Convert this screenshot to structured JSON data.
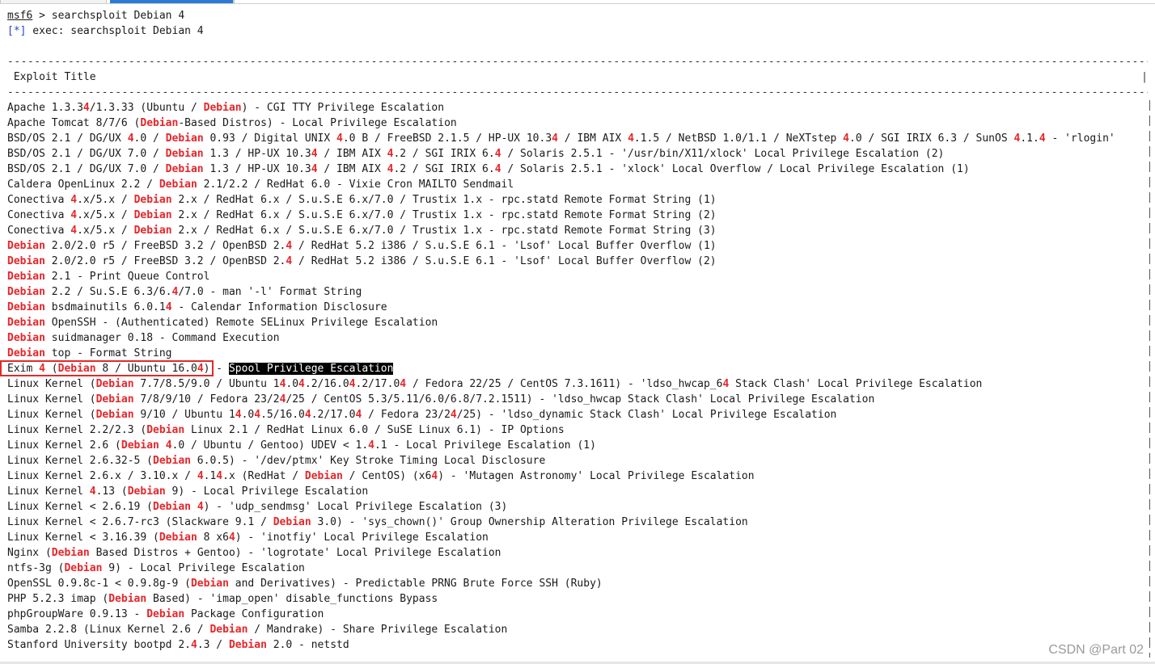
{
  "prompt": {
    "name": "msf6",
    "symbol": " > ",
    "command": "searchsploit Debian 4"
  },
  "exec_line": {
    "tag": "[*]",
    "text": " exec: searchsploit Debian 4"
  },
  "table": {
    "dash_rule": "----------------------------------------------------------------------------------------------------------------------------------------------------------------------------------------------------",
    "header": " Exploit Title",
    "header_edge": "|"
  },
  "rows": [
    [
      [
        "Apache 1.3.3",
        ""
      ],
      [
        "4",
        "r"
      ],
      [
        "/1.3.33 (Ubuntu / ",
        ""
      ],
      [
        "Debian",
        "r"
      ],
      [
        ") - CGI TTY Privilege Escalation",
        ""
      ]
    ],
    [
      [
        "Apache Tomcat 8/7/6 (",
        ""
      ],
      [
        "Debian",
        "r"
      ],
      [
        "-Based Distros) - Local Privilege Escalation",
        ""
      ]
    ],
    [
      [
        "BSD/OS 2.1 / DG/UX ",
        ""
      ],
      [
        "4",
        "r"
      ],
      [
        ".0 / ",
        ""
      ],
      [
        "Debian",
        "r"
      ],
      [
        " 0.93 / Digital UNIX ",
        ""
      ],
      [
        "4",
        "r"
      ],
      [
        ".0 B / FreeBSD 2.1.5 / HP-UX 10.3",
        ""
      ],
      [
        "4",
        "r"
      ],
      [
        " / IBM AIX ",
        ""
      ],
      [
        "4",
        "r"
      ],
      [
        ".1.5 / NetBSD 1.0/1.1 / NeXTstep ",
        ""
      ],
      [
        "4",
        "r"
      ],
      [
        ".0 / SGI IRIX 6.3 / SunOS ",
        ""
      ],
      [
        "4",
        "r"
      ],
      [
        ".1.",
        ""
      ],
      [
        "4",
        "r"
      ],
      [
        " - 'rlogin'",
        ""
      ]
    ],
    [
      [
        "BSD/OS 2.1 / DG/UX 7.0 / ",
        ""
      ],
      [
        "Debian",
        "r"
      ],
      [
        " 1.3 / HP-UX 10.3",
        ""
      ],
      [
        "4",
        "r"
      ],
      [
        " / IBM AIX ",
        ""
      ],
      [
        "4",
        "r"
      ],
      [
        ".2 / SGI IRIX 6.",
        ""
      ],
      [
        "4",
        "r"
      ],
      [
        " / Solaris 2.5.1 - '/usr/bin/X11/xlock' Local Privilege Escalation (2)",
        ""
      ]
    ],
    [
      [
        "BSD/OS 2.1 / DG/UX 7.0 / ",
        ""
      ],
      [
        "Debian",
        "r"
      ],
      [
        " 1.3 / HP-UX 10.3",
        ""
      ],
      [
        "4",
        "r"
      ],
      [
        " / IBM AIX ",
        ""
      ],
      [
        "4",
        "r"
      ],
      [
        ".2 / SGI IRIX 6.",
        ""
      ],
      [
        "4",
        "r"
      ],
      [
        " / Solaris 2.5.1 - 'xlock' Local Overflow / Local Privilege Escalation (1)",
        ""
      ]
    ],
    [
      [
        "Caldera OpenLinux 2.2 / ",
        ""
      ],
      [
        "Debian",
        "r"
      ],
      [
        " 2.1/2.2 / RedHat 6.0 - Vixie Cron MAILTO Sendmail",
        ""
      ]
    ],
    [
      [
        "Conectiva ",
        ""
      ],
      [
        "4",
        "r"
      ],
      [
        ".x/5.x / ",
        ""
      ],
      [
        "Debian",
        "r"
      ],
      [
        " 2.x / RedHat 6.x / S.u.S.E 6.x/7.0 / Trustix 1.x - rpc.statd Remote Format String (1)",
        ""
      ]
    ],
    [
      [
        "Conectiva ",
        ""
      ],
      [
        "4",
        "r"
      ],
      [
        ".x/5.x / ",
        ""
      ],
      [
        "Debian",
        "r"
      ],
      [
        " 2.x / RedHat 6.x / S.u.S.E 6.x/7.0 / Trustix 1.x - rpc.statd Remote Format String (2)",
        ""
      ]
    ],
    [
      [
        "Conectiva ",
        ""
      ],
      [
        "4",
        "r"
      ],
      [
        ".x/5.x / ",
        ""
      ],
      [
        "Debian",
        "r"
      ],
      [
        " 2.x / RedHat 6.x / S.u.S.E 6.x/7.0 / Trustix 1.x - rpc.statd Remote Format String (3)",
        ""
      ]
    ],
    [
      [
        "Debian",
        "r"
      ],
      [
        " 2.0/2.0 r5 / FreeBSD 3.2 / OpenBSD 2.",
        ""
      ],
      [
        "4",
        "r"
      ],
      [
        " / RedHat 5.2 i386 / S.u.S.E 6.1 - 'Lsof' Local Buffer Overflow (1)",
        ""
      ]
    ],
    [
      [
        "Debian",
        "r"
      ],
      [
        " 2.0/2.0 r5 / FreeBSD 3.2 / OpenBSD 2.",
        ""
      ],
      [
        "4",
        "r"
      ],
      [
        " / RedHat 5.2 i386 / S.u.S.E 6.1 - 'Lsof' Local Buffer Overflow (2)",
        ""
      ]
    ],
    [
      [
        "Debian",
        "r"
      ],
      [
        " 2.1 - Print Queue Control",
        ""
      ]
    ],
    [
      [
        "Debian",
        "r"
      ],
      [
        " 2.2 / Su.S.E 6.3/6.",
        ""
      ],
      [
        "4",
        "r"
      ],
      [
        "/7.0 - man '-l' Format String",
        ""
      ]
    ],
    [
      [
        "Debian",
        "r"
      ],
      [
        " bsdmainutils 6.0.1",
        ""
      ],
      [
        "4",
        "r"
      ],
      [
        " - Calendar Information Disclosure",
        ""
      ]
    ],
    [
      [
        "Debian",
        "r"
      ],
      [
        " OpenSSH - (Authenticated) Remote SELinux Privilege Escalation",
        ""
      ]
    ],
    [
      [
        "Debian",
        "r"
      ],
      [
        " suidmanager 0.18 - Command Execution",
        ""
      ]
    ],
    [
      [
        "Debian",
        "r"
      ],
      [
        " top - Format String",
        ""
      ]
    ],
    [
      [
        "Exim ",
        ""
      ],
      [
        "4",
        "r"
      ],
      [
        " (",
        ""
      ],
      [
        "Debian",
        "r"
      ],
      [
        " 8 / Ubuntu 16.0",
        ""
      ],
      [
        "4",
        "r"
      ],
      [
        ") - ",
        ""
      ],
      [
        "Spool Privilege Escalation",
        "s"
      ]
    ],
    [
      [
        "Linux Kernel (",
        ""
      ],
      [
        "Debian",
        "r"
      ],
      [
        " 7.7/8.5/9.0 / Ubuntu 1",
        ""
      ],
      [
        "4",
        "r"
      ],
      [
        ".0",
        ""
      ],
      [
        "4",
        "r"
      ],
      [
        ".2/16.0",
        ""
      ],
      [
        "4",
        "r"
      ],
      [
        ".2/17.0",
        ""
      ],
      [
        "4",
        "r"
      ],
      [
        " / Fedora 22/25 / CentOS 7.3.1611) - 'ldso_hwcap_6",
        ""
      ],
      [
        "4",
        "r"
      ],
      [
        " Stack Clash' Local Privilege Escalation",
        ""
      ]
    ],
    [
      [
        "Linux Kernel (",
        ""
      ],
      [
        "Debian",
        "r"
      ],
      [
        " 7/8/9/10 / Fedora 23/2",
        ""
      ],
      [
        "4",
        "r"
      ],
      [
        "/25 / CentOS 5.3/5.11/6.0/6.8/7.2.1511) - 'ldso_hwcap Stack Clash' Local Privilege Escalation",
        ""
      ]
    ],
    [
      [
        "Linux Kernel (",
        ""
      ],
      [
        "Debian",
        "r"
      ],
      [
        " 9/10 / Ubuntu 1",
        ""
      ],
      [
        "4",
        "r"
      ],
      [
        ".0",
        ""
      ],
      [
        "4",
        "r"
      ],
      [
        ".5/16.0",
        ""
      ],
      [
        "4",
        "r"
      ],
      [
        ".2/17.0",
        ""
      ],
      [
        "4",
        "r"
      ],
      [
        " / Fedora 23/2",
        ""
      ],
      [
        "4",
        "r"
      ],
      [
        "/25) - 'ldso_dynamic Stack Clash' Local Privilege Escalation",
        ""
      ]
    ],
    [
      [
        "Linux Kernel 2.2/2.3 (",
        ""
      ],
      [
        "Debian",
        "r"
      ],
      [
        " Linux 2.1 / RedHat Linux 6.0 / SuSE Linux 6.1) - IP Options",
        ""
      ]
    ],
    [
      [
        "Linux Kernel 2.6 (",
        ""
      ],
      [
        "Debian",
        "r"
      ],
      [
        " ",
        ""
      ],
      [
        "4",
        "r"
      ],
      [
        ".0 / Ubuntu / Gentoo) UDEV < 1.",
        ""
      ],
      [
        "4",
        "r"
      ],
      [
        ".1 - Local Privilege Escalation (1)",
        ""
      ]
    ],
    [
      [
        "Linux Kernel 2.6.32-5 (",
        ""
      ],
      [
        "Debian",
        "r"
      ],
      [
        " 6.0.5) - '/dev/ptmx' Key Stroke Timing Local Disclosure",
        ""
      ]
    ],
    [
      [
        "Linux Kernel 2.6.x / 3.10.x / ",
        ""
      ],
      [
        "4",
        "r"
      ],
      [
        ".1",
        ""
      ],
      [
        "4",
        "r"
      ],
      [
        ".x (RedHat / ",
        ""
      ],
      [
        "Debian",
        "r"
      ],
      [
        " / CentOS) (x6",
        ""
      ],
      [
        "4",
        "r"
      ],
      [
        ") - 'Mutagen Astronomy' Local Privilege Escalation",
        ""
      ]
    ],
    [
      [
        "Linux Kernel ",
        ""
      ],
      [
        "4",
        "r"
      ],
      [
        ".13 (",
        ""
      ],
      [
        "Debian",
        "r"
      ],
      [
        " 9) - Local Privilege Escalation",
        ""
      ]
    ],
    [
      [
        "Linux Kernel < 2.6.19 (",
        ""
      ],
      [
        "Debian",
        "r"
      ],
      [
        " ",
        ""
      ],
      [
        "4",
        "r"
      ],
      [
        ") - 'udp_sendmsg' Local Privilege Escalation (3)",
        ""
      ]
    ],
    [
      [
        "Linux Kernel < 2.6.7-rc3 (Slackware 9.1 / ",
        ""
      ],
      [
        "Debian",
        "r"
      ],
      [
        " 3.0) - 'sys_chown()' Group Ownership Alteration Privilege Escalation",
        ""
      ]
    ],
    [
      [
        "Linux Kernel < 3.16.39 (",
        ""
      ],
      [
        "Debian",
        "r"
      ],
      [
        " 8 x6",
        ""
      ],
      [
        "4",
        "r"
      ],
      [
        ") - 'inotfiy' Local Privilege Escalation",
        ""
      ]
    ],
    [
      [
        "Nginx (",
        ""
      ],
      [
        "Debian",
        "r"
      ],
      [
        " Based Distros + Gentoo) - 'logrotate' Local Privilege Escalation",
        ""
      ]
    ],
    [
      [
        "ntfs-3g (",
        ""
      ],
      [
        "Debian",
        "r"
      ],
      [
        " 9) - Local Privilege Escalation",
        ""
      ]
    ],
    [
      [
        "OpenSSL 0.9.8c-1 < 0.9.8g-9 (",
        ""
      ],
      [
        "Debian",
        "r"
      ],
      [
        " and Derivatives) - Predictable PRNG Brute Force SSH (Ruby)",
        ""
      ]
    ],
    [
      [
        "PHP 5.2.3 imap (",
        ""
      ],
      [
        "Debian",
        "r"
      ],
      [
        " Based) - 'imap_open' disable_functions Bypass",
        ""
      ]
    ],
    [
      [
        "phpGroupWare 0.9.13 - ",
        ""
      ],
      [
        "Debian",
        "r"
      ],
      [
        " Package Configuration",
        ""
      ]
    ],
    [
      [
        "Samba 2.2.8 (Linux Kernel 2.6 / ",
        ""
      ],
      [
        "Debian",
        "r"
      ],
      [
        " / Mandrake) - Share Privilege Escalation",
        ""
      ]
    ],
    [
      [
        "Stanford University bootpd 2.",
        ""
      ],
      [
        "4",
        "r"
      ],
      [
        ".3 / ",
        ""
      ],
      [
        "Debian",
        "r"
      ],
      [
        " 2.0 - netstd",
        ""
      ]
    ]
  ],
  "watermark": "CSDN @Part 02",
  "colors": {
    "match_highlight": "#e5262a",
    "info_tag": "#2545d0",
    "box_outline": "#e32a2a",
    "selection_bg": "#000000"
  }
}
